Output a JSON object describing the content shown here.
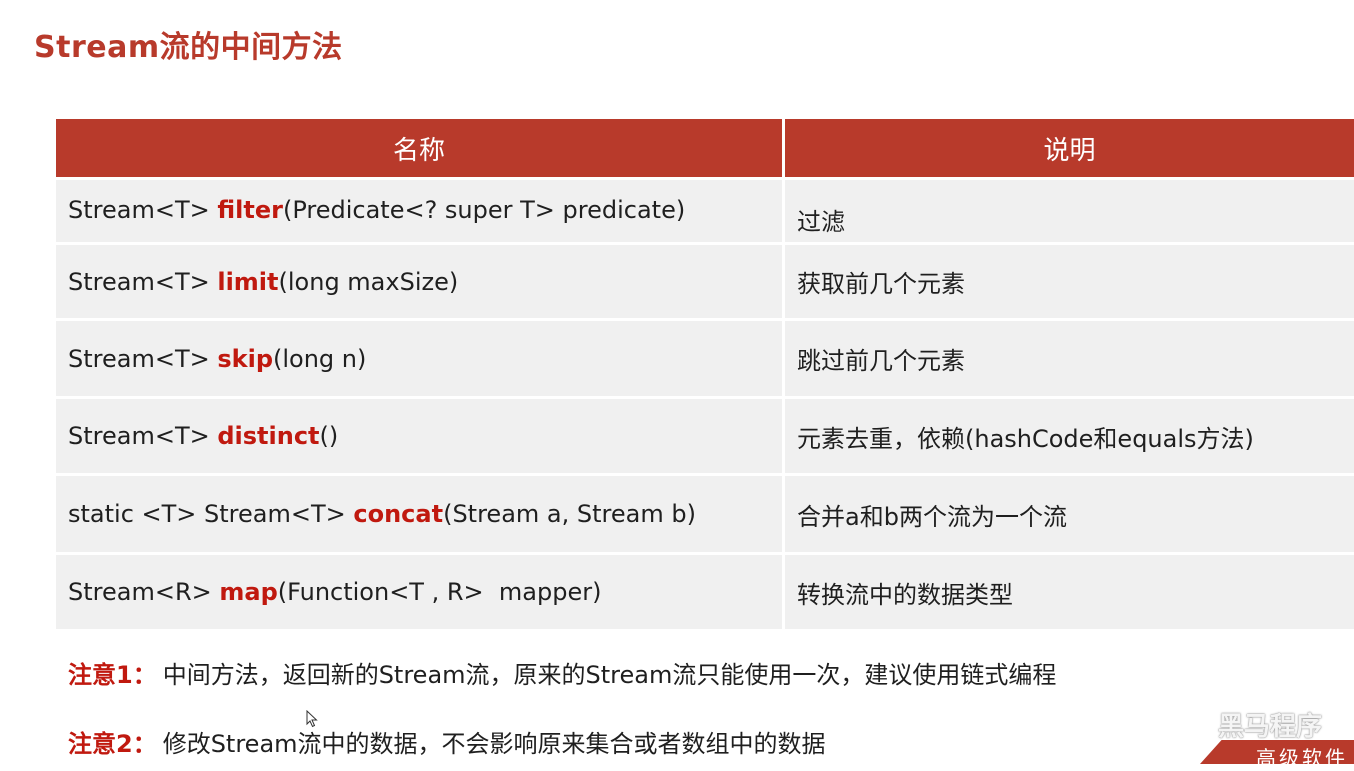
{
  "title": "Stream流的中间方法",
  "table": {
    "headers": {
      "name": "名称",
      "desc": "说明"
    },
    "rows": [
      {
        "prefix": "Stream<T> ",
        "method": "filter",
        "suffix": "(Predicate<? super T> predicate)",
        "desc": "过滤"
      },
      {
        "prefix": "Stream<T> ",
        "method": "limit",
        "suffix": "(long maxSize)",
        "desc": "获取前几个元素"
      },
      {
        "prefix": "Stream<T> ",
        "method": "skip",
        "suffix": "(long n)",
        "desc": "跳过前几个元素"
      },
      {
        "prefix": "Stream<T> ",
        "method": "distinct",
        "suffix": "()",
        "desc": "元素去重，依赖(hashCode和equals方法)"
      },
      {
        "prefix": "static <T> Stream<T> ",
        "method": "concat",
        "suffix": "(Stream a, Stream b)",
        "desc": "合并a和b两个流为一个流"
      },
      {
        "prefix": "Stream<R> ",
        "method": "map",
        "suffix": "(Function<T , R>  mapper)",
        "desc": "转换流中的数据类型"
      }
    ]
  },
  "notes": [
    {
      "label": "注意1：",
      "text": "中间方法，返回新的Stream流，原来的Stream流只能使用一次，建议使用链式编程"
    },
    {
      "label": "注意2：",
      "text": "修改Stream流中的数据，不会影响原来集合或者数组中的数据"
    }
  ],
  "watermark": {
    "text": "黑马程序",
    "banner": "高级软件"
  },
  "colors": {
    "accent": "#b83a2b",
    "keyword": "#c0190f",
    "row_bg": "#f0f0f0"
  }
}
